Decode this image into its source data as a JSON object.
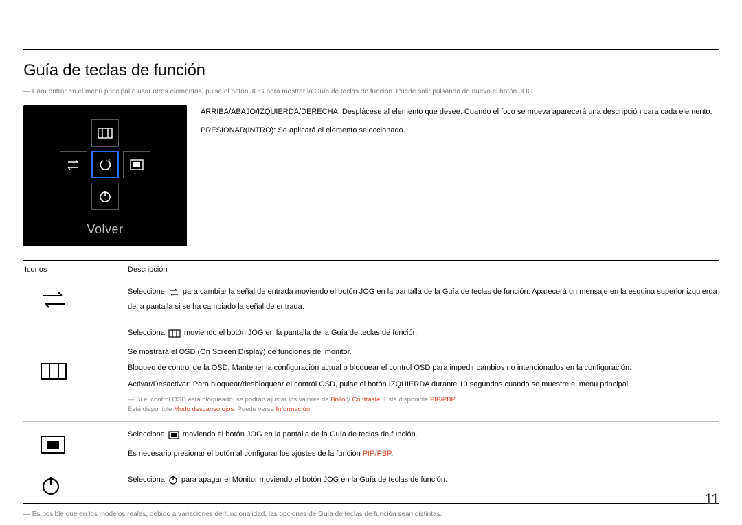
{
  "title": "Guía de teclas de función",
  "intro_note": "Para entrar en el menú principal o usar otros elementos, pulse el botón JOG para mostrar la Guía de teclas de función. Puede salir pulsando de nuevo el botón JOG.",
  "top_text": {
    "line1": "ARRIBA/ABAJO/IZQUIERDA/DERECHA: Desplácese al elemento que desee. Cuando el foco se mueva aparecerá una descripción para cada elemento.",
    "line2": "PRESIONAR(INTRO): Se aplicará el elemento seleccionado."
  },
  "osd": {
    "label": "Volver"
  },
  "table": {
    "headers": {
      "icons": "Iconos",
      "desc": "Descripción"
    },
    "row_source": {
      "p1a": "Seleccione ",
      "p1b": " para cambiar la señal de entrada moviendo el botón JOG en la pantalla de la Guía de teclas de función. Aparecerá un mensaje en la esquina superior izquierda de la pantalla si se ha cambiado la señal de entrada."
    },
    "row_menu": {
      "p1a": "Selecciona ",
      "p1b": " moviendo el botón JOG en la pantalla de la Guía de teclas de función.",
      "p2": "Se mostrará el OSD (On Screen Display) de funciones del monitor.",
      "p3": "Bloqueo de control de la OSD: Mantener la configuración actual o bloquear el control OSD para impedir cambios no intencionados en la configuración.",
      "p4": "Activar/Desactivar: Para bloquear/desbloquear el control OSD, pulse el botón IZQUIERDA durante 10 segundos cuando se muestre el menú principal.",
      "note_a": "Si el control OSD está bloqueado, se podrán ajustar los valores de ",
      "note_brillo": "Brillo",
      "note_y": " y ",
      "note_contraste": "Contraste",
      "note_mid": ". Está disponible ",
      "note_pip": "PIP/PBP",
      "note_dot": ".",
      "note_b1": "Está disponible ",
      "note_modo": "Modo descanso ojos",
      "note_b2": ". Puede verse ",
      "note_info": "Información",
      "note_b3": "."
    },
    "row_pip": {
      "p1a": "Selecciona ",
      "p1b": " moviendo el botón JOG en la pantalla de la Guía de teclas de función.",
      "p2a": "Es necesario presionar el botón al configurar los ajustes de la función ",
      "p2_pip": "PIP/PBP",
      "p2b": "."
    },
    "row_power": {
      "p1a": "Selecciona ",
      "p1b": " para apagar el Monitor moviendo el botón JOG en la Guía de teclas de función."
    }
  },
  "footer_note": "Es posible que en los modelos reales, debido a variaciones de funcionalidad, las opciones de Guía de teclas de función sean distintas.",
  "page_number": "11"
}
